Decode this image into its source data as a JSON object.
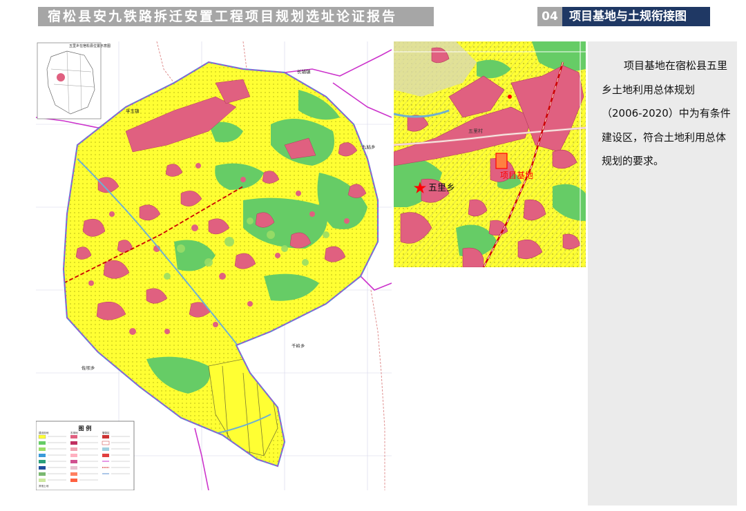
{
  "header": {
    "title": "宿松县安九铁路拆迁安置工程项目规划选址论证报告",
    "section_number": "04",
    "section_title": "项目基地与土规衔接图"
  },
  "main_map": {
    "locator_caption": "五里乡在宿松县位置示意图",
    "place_labels": {
      "changpu": "长铺镇",
      "fuyu": "孚玉镇",
      "jiugu": "九姑乡",
      "qianling": "千岭乡",
      "zuoba": "佐坝乡"
    },
    "legend": {
      "title": "图  例",
      "groups": [
        "建设用地",
        "农用地",
        "其他土地",
        "管制区"
      ]
    }
  },
  "inset_map": {
    "township_label": "五里乡",
    "village_label": "五里村",
    "project_label": "项目基地"
  },
  "description": "项目基地在宿松县五里乡土地利用总体规划（2006-2020）中为有条件建设区，符合土地利用总体规划的要求。",
  "colors": {
    "header_gray": "#a6a6a6",
    "header_navy": "#1f3864",
    "basic_farmland": "#ffff33",
    "general_farmland": "#66cc66",
    "construction_land": "#e06080",
    "water": "#9fd8e8",
    "boundary": "#cc33cc",
    "project_marker": "#ff0000",
    "side_panel": "#ebebeb"
  }
}
